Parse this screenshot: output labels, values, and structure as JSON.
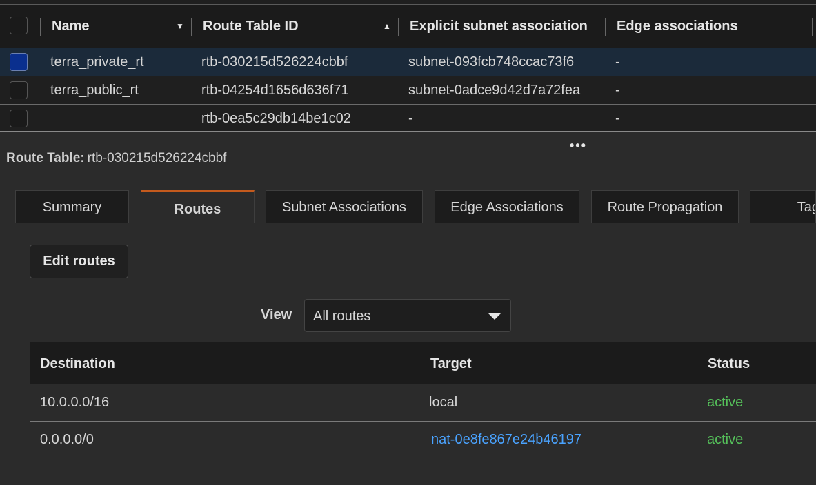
{
  "route_tables": {
    "columns": {
      "name": "Name",
      "route_table_id": "Route Table ID",
      "explicit_subnet": "Explicit subnet association",
      "edge": "Edge associations"
    },
    "rows": [
      {
        "name": "terra_private_rt",
        "id": "rtb-030215d526224cbbf",
        "subnet": "subnet-093fcb748ccac73f6",
        "edge": "-",
        "selected": true
      },
      {
        "name": "terra_public_rt",
        "id": "rtb-04254d1656d636f71",
        "subnet": "subnet-0adce9d42d7a72fea",
        "edge": "-",
        "selected": false
      },
      {
        "name": "",
        "id": "rtb-0ea5c29db14be1c02",
        "subnet": "-",
        "edge": "-",
        "selected": false
      }
    ]
  },
  "detail": {
    "heading_label": "Route Table:",
    "heading_value": "rtb-030215d526224cbbf",
    "tabs": [
      "Summary",
      "Routes",
      "Subnet Associations",
      "Edge Associations",
      "Route Propagation",
      "Tags"
    ],
    "active_tab": "Routes",
    "edit_button": "Edit routes",
    "view_label": "View",
    "view_selected": "All routes",
    "routes_columns": {
      "destination": "Destination",
      "target": "Target",
      "status": "Status"
    },
    "routes": [
      {
        "destination": "10.0.0.0/16",
        "target": "local",
        "status": "active",
        "target_is_link": false
      },
      {
        "destination": "0.0.0.0/0",
        "target": "nat-0e8fe867e24b46197",
        "status": "active",
        "target_is_link": true
      }
    ]
  },
  "colors": {
    "accent_tab": "#c45a1d",
    "link": "#4aa3ff",
    "status_active": "#55c05a",
    "checkbox_selected": "#0a2f8e"
  }
}
